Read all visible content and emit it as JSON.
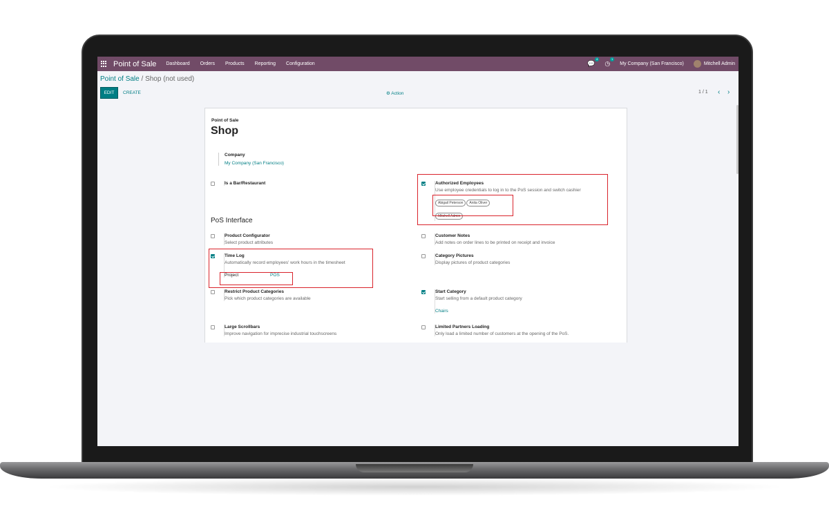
{
  "navbar": {
    "app_title": "Point of Sale",
    "menu": [
      "Dashboard",
      "Orders",
      "Products",
      "Reporting",
      "Configuration"
    ],
    "messages_badge": "4",
    "activities_badge": "1",
    "company": "My Company (San Francisco)",
    "user": "Mitchell Admin",
    "brand_color": "#714b67"
  },
  "breadcrumb": {
    "parent": "Point of Sale",
    "separator": "/",
    "current": "Shop (not used)"
  },
  "controls": {
    "edit_label": "EDIT",
    "create_label": "CREATE",
    "action_label": "⚙ Action",
    "pager": "1 / 1",
    "prev": "‹",
    "next": "›"
  },
  "form": {
    "subtitle": "Point of Sale",
    "title": "Shop",
    "company_label": "Company",
    "company_value": "My Company (San Francisco)",
    "bar_restaurant": {
      "title": "Is a Bar/Restaurant",
      "checked": false
    },
    "authorized_employees": {
      "title": "Authorized Employees",
      "desc": "Use employee credentials to log in to the PoS session and switch cashier",
      "checked": true,
      "tags": [
        "Abigail Peterson",
        "Anita Oliver",
        "Mitchell Admin"
      ]
    },
    "section_title": "PoS Interface",
    "product_configurator": {
      "title": "Product Configurator",
      "desc": "Select product attributes",
      "checked": false
    },
    "customer_notes": {
      "title": "Customer Notes",
      "desc": "Add notes on order lines to be printed on receipt and invoice",
      "checked": false
    },
    "time_log": {
      "title": "Time Log",
      "desc": "Automatically record employees' work hours in the timesheet",
      "checked": true,
      "project_label": "Project",
      "project_value": "POS"
    },
    "category_pictures": {
      "title": "Category Pictures",
      "desc": "Display pictures of product categories",
      "checked": false
    },
    "restrict_categories": {
      "title": "Restrict Product Categories",
      "desc": "Pick which product categories are available",
      "checked": false
    },
    "start_category": {
      "title": "Start Category",
      "desc": "Start selling from a default product category",
      "checked": true,
      "value": "Chairs"
    },
    "large_scrollbars": {
      "title": "Large Scrollbars",
      "desc": "Improve navigation for imprecise industrial touchscreens",
      "checked": false
    },
    "limited_partners": {
      "title": "Limited Partners Loading",
      "desc": "Only load a limited number of customers at the opening of the PoS.",
      "checked": false
    }
  },
  "colors": {
    "accent": "#017e84",
    "highlight": "#d9222a"
  }
}
